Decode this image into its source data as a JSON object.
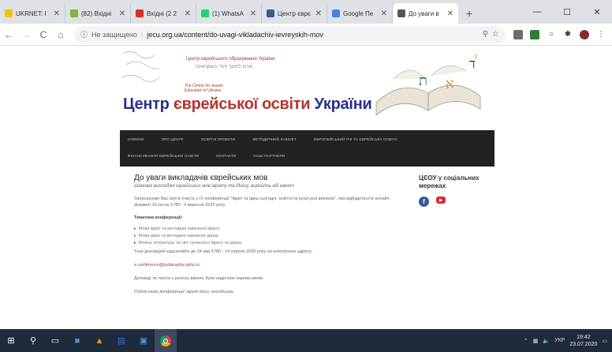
{
  "browser": {
    "tabs": [
      {
        "title": "UKRNET: I",
        "color": "#f4c20d"
      },
      {
        "title": "(82) Вхідні",
        "color": "#7bb742"
      },
      {
        "title": "Вхідні (2 2",
        "color": "#d93025"
      },
      {
        "title": "(1) WhatsA",
        "color": "#25d366"
      },
      {
        "title": "Центр єврє",
        "color": "#3b5998"
      },
      {
        "title": "Google Пе",
        "color": "#4285f4"
      },
      {
        "title": "До уваги в",
        "color": "#555555"
      }
    ],
    "new_tab": "+",
    "window_controls": {
      "minimize": "—",
      "maximize": "☐",
      "close": "✕"
    },
    "nav": {
      "back": "←",
      "forward": "→",
      "reload": "C",
      "home": "⌂"
    },
    "security": "Не защищено",
    "url": "jecu.org.ua/content/do-uvagi-vikladachiv-ievreyskih-mov"
  },
  "site": {
    "org_ua": "Центр єврейського образування України",
    "org_he": "מרכז לחינוך יהודי באוקראינה",
    "org_en": "The Centre for Jewish Education of Ukraine",
    "logo": {
      "p1": "Центр ",
      "p2": "єврейської освіти ",
      "p3": "України"
    },
    "menu_row1": [
      "Новини",
      "Про центр",
      "Освітні проекти",
      "Методичний кабінет",
      "Європейський рік та єврейська освіта"
    ],
    "menu_row2": [
      "Фінансування єврейської освіти",
      "Контакти",
      "Наші партнери"
    ]
  },
  "article": {
    "title": "До уваги викладачів єврейських мов",
    "subtitle": "Шановні викладачі єврейських мов іврату та ідишу, вирішіть від евент",
    "intro": "Запрошуємо Вас взяти участь у IV конференції \"Іврит та ідиш сьогодні: освітні та культурні виклики\", яка відбудеться в онлайн форматі 16 хеслу 5780 - 6 вересня 2020 року.",
    "topics_heading": "Тематика конференції:",
    "topics": [
      "Мова іврит та методика навчання іврату.",
      "Мова ідиш та методика навчання ідишу.",
      "Мовна література та світ сучасного іврату та ідишу."
    ],
    "deadline": "Тези доповідей надсилайте до 24 ава 5780 - 14 серпня 2020 року на електронну адресу:",
    "email": "e.conference@judaicaphy.uphs.tu",
    "note": "Доповіді та тексти з регіону вміють були надіслані окремо меню.",
    "footer": "Робочі мови конференції: іврит ідиш, англійська."
  },
  "sidebar": {
    "title": "ЦЄОУ у соціальних мережах"
  },
  "taskbar": {
    "lang": "УКР",
    "time": "19:42",
    "date": "23.07.2020"
  }
}
